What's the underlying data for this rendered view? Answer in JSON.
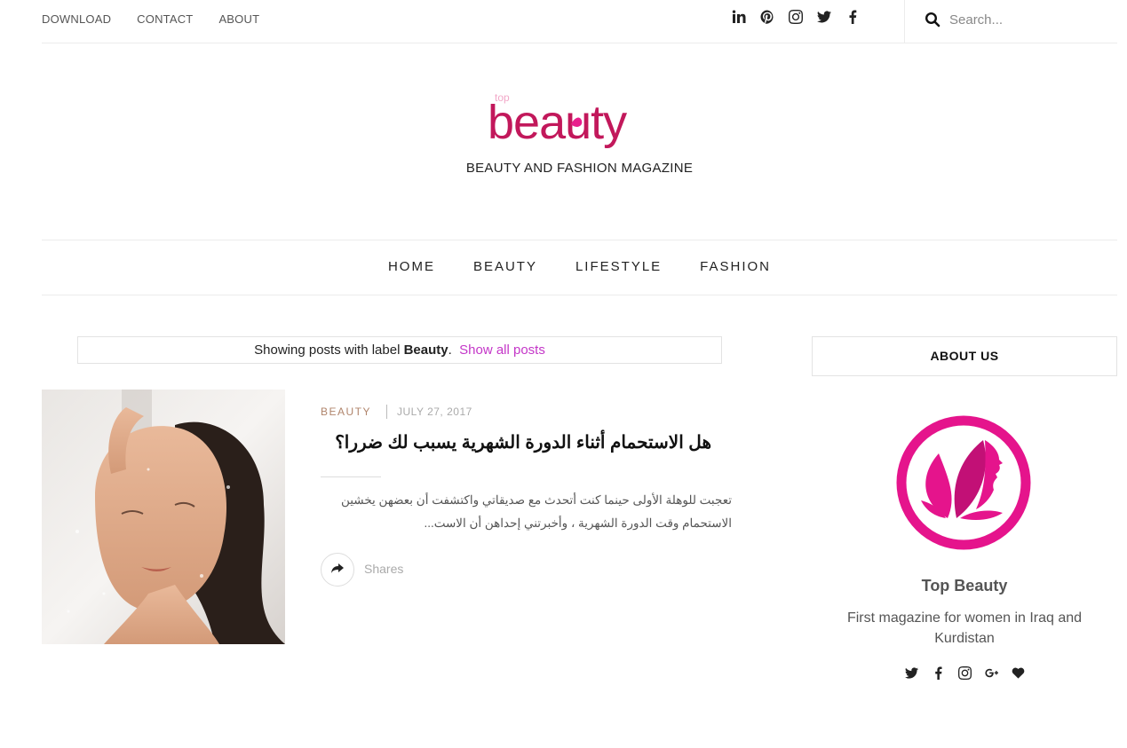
{
  "topbar": {
    "links": [
      "DOWNLOAD",
      "CONTACT",
      "ABOUT"
    ],
    "social_icons": [
      "linkedin-icon",
      "pinterest-icon",
      "instagram-icon",
      "twitter-icon",
      "facebook-icon"
    ],
    "search_placeholder": "Search..."
  },
  "brand": {
    "logo_small_text": "top",
    "logo_text": "beauty",
    "tagline": "BEAUTY AND FASHION MAGAZINE",
    "primary_color": "#c2185b",
    "accent_color": "#e91e8c"
  },
  "main_nav": [
    "HOME",
    "BEAUTY",
    "LIFESTYLE",
    "FASHION"
  ],
  "label_notice": {
    "prefix": "Showing posts with label ",
    "label": "Beauty",
    "suffix": ".",
    "show_all": "Show all posts"
  },
  "post": {
    "category": "BEAUTY",
    "date": "JULY 27, 2017",
    "title": "هل الاستحمام أثناء الدورة الشهرية يسبب لك ضررا؟",
    "excerpt": "تعجبت للوهلة الأولى حينما كنت أتحدث مع صديقاتي واكتشفت أن بعضهن يخشين الاستحمام وقت الدورة الشهرية ، وأخبرتني إحداهن أن الاست...",
    "shares_label": "Shares"
  },
  "sidebar": {
    "widget_title": "ABOUT US",
    "name": "Top Beauty",
    "description": "First magazine for women in Iraq and Kurdistan",
    "social_icons": [
      "twitter-icon",
      "facebook-icon",
      "instagram-icon",
      "google-plus-icon",
      "heart-icon"
    ]
  }
}
